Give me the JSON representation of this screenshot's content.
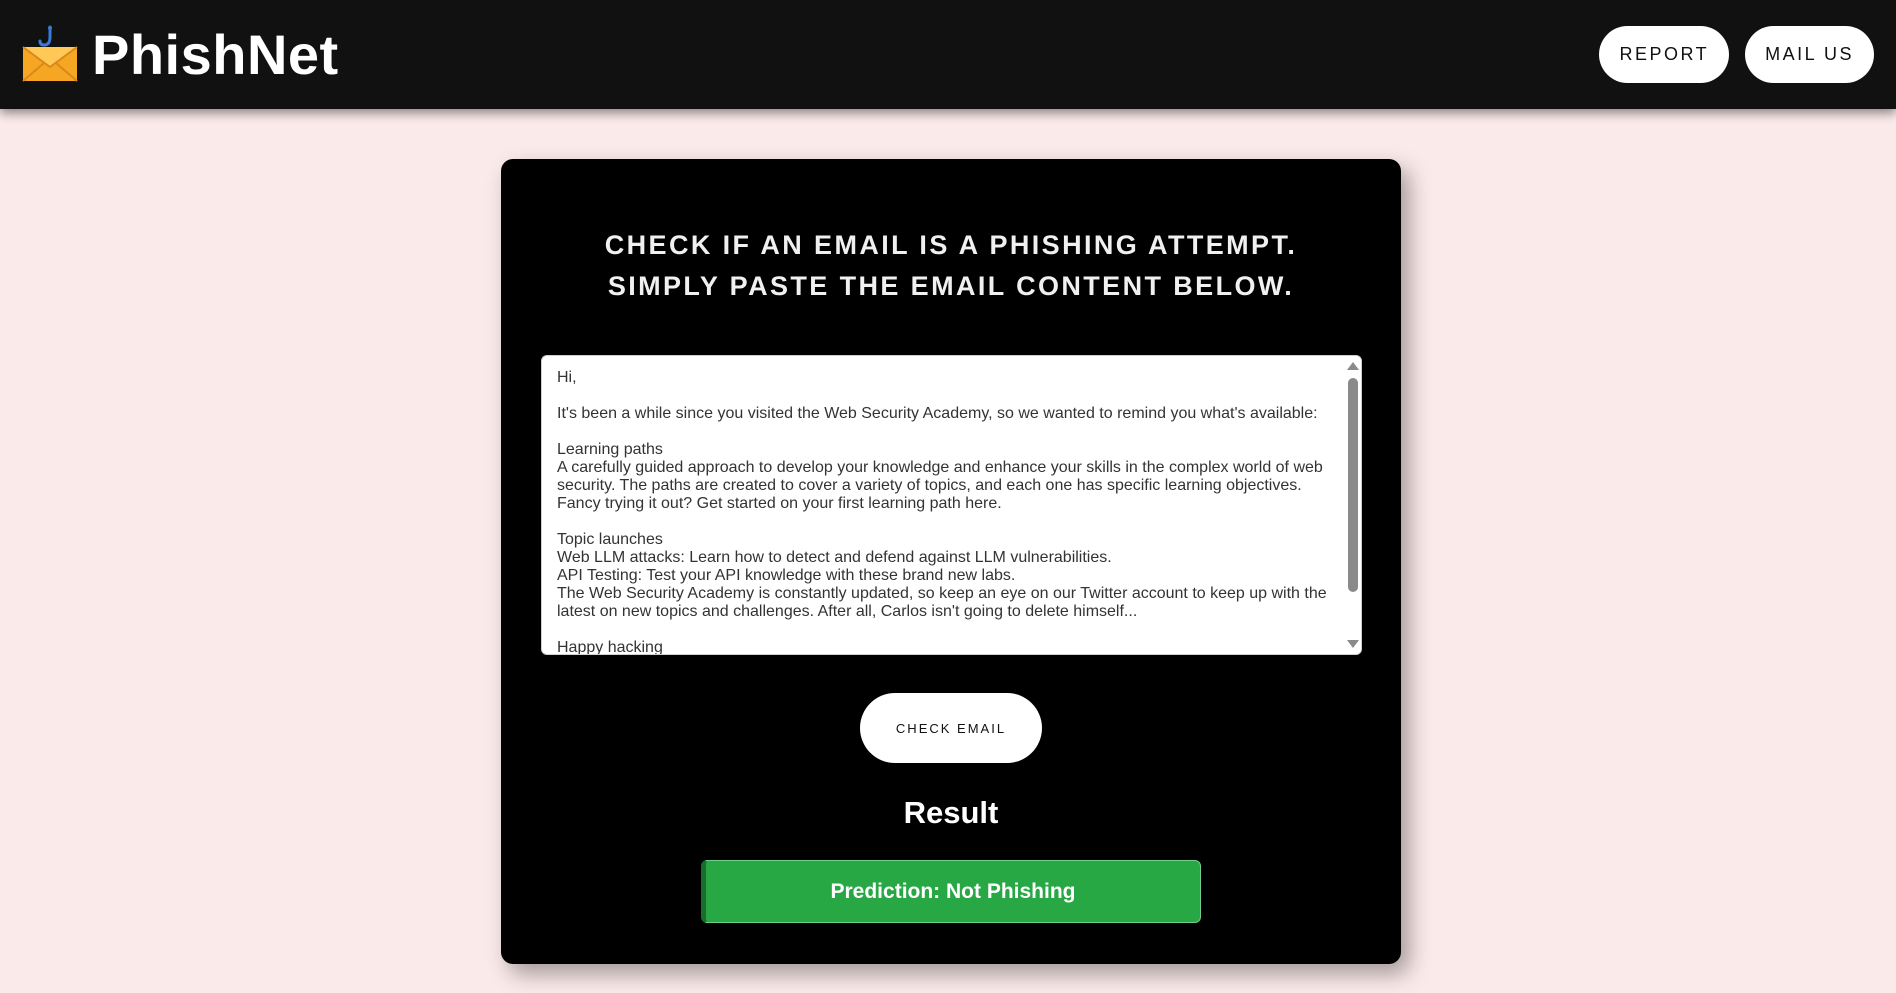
{
  "header": {
    "brand_name": "PhishNet",
    "logo_icon": "envelope-with-fishhook-icon",
    "nav": {
      "report_label": "REPORT",
      "mail_us_label": "MAIL US"
    }
  },
  "main": {
    "headline_line1": "CHECK IF AN EMAIL IS A PHISHING ATTEMPT.",
    "headline_line2": "SIMPLY PASTE THE EMAIL CONTENT BELOW.",
    "email_content": "Hi,\n\nIt's been a while since you visited the Web Security Academy, so we wanted to remind you what's available:\n\nLearning paths\nA carefully guided approach to develop your knowledge and enhance your skills in the complex world of web security. The paths are created to cover a variety of topics, and each one has specific learning objectives. Fancy trying it out? Get started on your first learning path here.\n\nTopic launches\nWeb LLM attacks: Learn how to detect and defend against LLM vulnerabilities.\nAPI Testing: Test your API knowledge with these brand new labs.\nThe Web Security Academy is constantly updated, so keep an eye on our Twitter account to keep up with the latest on new topics and challenges. After all, Carlos isn't going to delete himself...\n\nHappy hacking",
    "check_button_label": "CHECK EMAIL",
    "result_title": "Result",
    "result_text": "Prediction: Not Phishing"
  },
  "colors": {
    "page_background": "#fbeaea",
    "header_background": "#111111",
    "card_background": "#000000",
    "result_success": "#28a745"
  }
}
